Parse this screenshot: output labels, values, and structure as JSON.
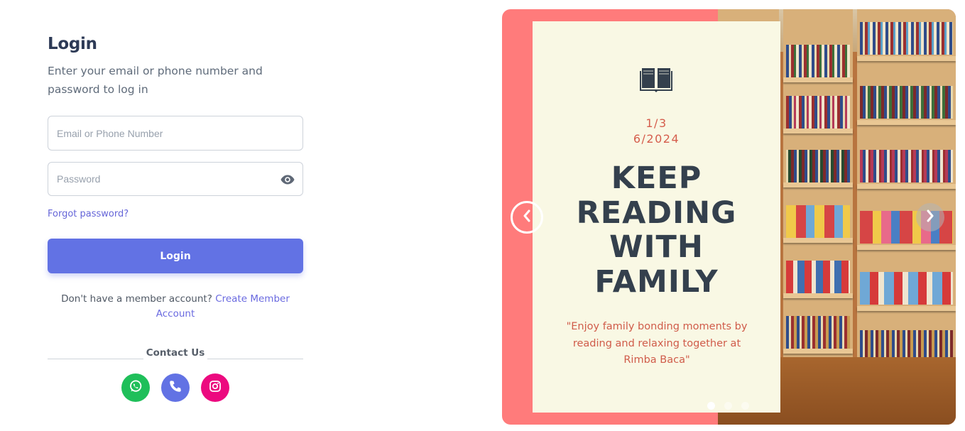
{
  "login": {
    "title": "Login",
    "subtitle": "Enter your email or phone number and password to log in",
    "email_placeholder": "Email or Phone Number",
    "email_value": "",
    "password_placeholder": "Password",
    "password_value": "",
    "show_password_icon": "eye-icon",
    "forgot_password": "Forgot password?",
    "submit_label": "Login",
    "signup_prompt": "Don't have a member account?",
    "signup_link": "Create Member Account",
    "contact_label": "Contact Us",
    "contacts": [
      {
        "name": "whatsapp",
        "icon": "whatsapp-icon",
        "color": "#1fbf5a"
      },
      {
        "name": "phone",
        "icon": "phone-icon",
        "color": "#6272e4"
      },
      {
        "name": "instagram",
        "icon": "instagram-icon",
        "color": "#ec0a7f"
      }
    ],
    "accent_color": "#6272e4"
  },
  "carousel": {
    "icon": "open-book-icon",
    "counter": "1/3",
    "date": "6/2024",
    "headline": "KEEP\nREADING\nWITH\nFAMILY",
    "quote": "\"Enjoy family bonding moments by reading and relaxing together at Rimba Baca\"",
    "current_slide": 1,
    "total_slides": 3,
    "prev_icon": "chevron-left-icon",
    "next_icon": "chevron-right-icon",
    "background_color": "#ff7b7b",
    "card_color": "#f9f8e4"
  }
}
